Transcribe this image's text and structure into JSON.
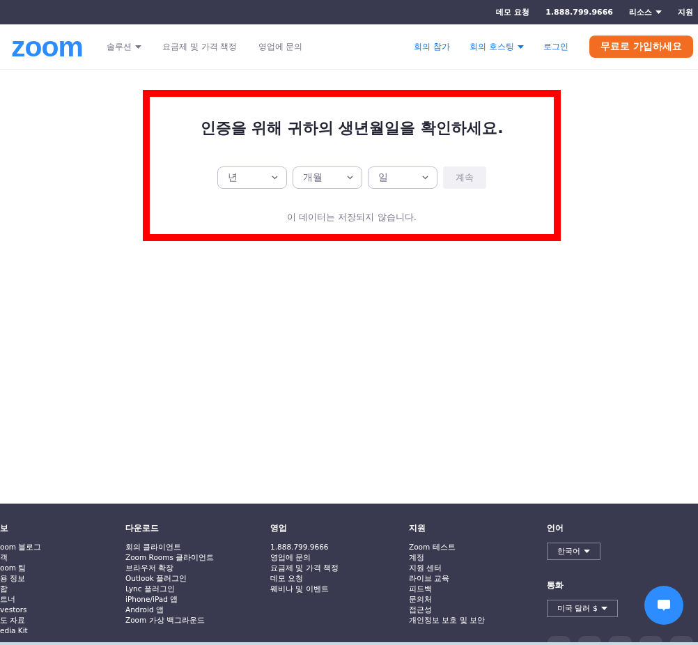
{
  "top_bar": {
    "links": [
      {
        "label": "데모 요청",
        "caret": false
      },
      {
        "label": "1.888.799.9666",
        "caret": false
      },
      {
        "label": "리소스",
        "caret": true
      },
      {
        "label": "지원",
        "caret": false
      }
    ]
  },
  "nav": {
    "logo": "zoom",
    "left_links": [
      {
        "label": "솔루션",
        "caret": true
      },
      {
        "label": "요금제 및 가격 책정",
        "caret": false
      },
      {
        "label": "영업에 문의",
        "caret": false
      }
    ],
    "right_links": [
      {
        "label": "회의 참가",
        "caret": false
      },
      {
        "label": "회의 호스팅",
        "caret": true
      },
      {
        "label": "로그인",
        "caret": false
      }
    ],
    "signup_button": "무료로 가입하세요"
  },
  "verification": {
    "title": "인증을 위해 귀하의 생년월일을 확인하세요.",
    "selects": [
      {
        "placeholder": "년"
      },
      {
        "placeholder": "개월"
      },
      {
        "placeholder": "일"
      }
    ],
    "continue_button": {
      "label": "계속",
      "disabled": true
    },
    "note": "이 데이터는 저장되지 않습니다."
  },
  "footer": {
    "columns": [
      {
        "heading": "보",
        "items": [
          "oom 블로그",
          "객",
          "oom 팀",
          "용 정보",
          "합",
          "트너",
          "vestors",
          "도 자료",
          "edia Kit"
        ]
      },
      {
        "heading": "다운로드",
        "items": [
          "회의 클라이언트",
          "Zoom Rooms 클라이언트",
          "브라우저 확장",
          "Outlook 플러그인",
          "Lync 플러그인",
          "iPhone/iPad 앱",
          "Android 앱",
          "Zoom 가상 백그라운드"
        ]
      },
      {
        "heading": "영업",
        "items": [
          "1.888.799.9666",
          "영업에 문의",
          "요금제 및 가격 책정",
          "데모 요청",
          "웨비나 및 이벤트"
        ]
      },
      {
        "heading": "지원",
        "items": [
          "Zoom 테스트",
          "계정",
          "지원 센터",
          "라이브 교육",
          "피드백",
          "문의처",
          "접근성",
          "개인정보 보호 및 보안"
        ]
      }
    ],
    "language": {
      "heading": "언어",
      "value": "한국어"
    },
    "currency": {
      "heading": "통화",
      "value": "미국 달러 $"
    }
  }
}
